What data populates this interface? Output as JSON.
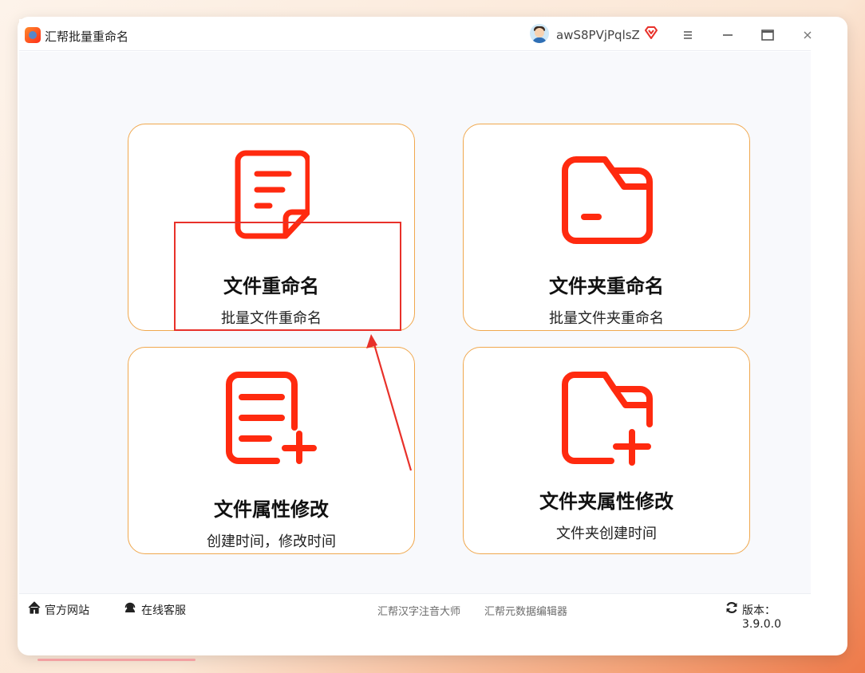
{
  "window": {
    "title": "汇帮批量重命名",
    "username": "awS8PVjPqlsZ",
    "controls": {
      "menu": "≡",
      "minimize": "—",
      "maximize": "▭",
      "close": "×"
    }
  },
  "cards": [
    {
      "title": "文件重命名",
      "subtitle": "批量文件重命名",
      "icon": "file-text-icon"
    },
    {
      "title": "文件夹重命名",
      "subtitle": "批量文件夹重命名",
      "icon": "folder-icon"
    },
    {
      "title": "文件属性修改",
      "subtitle": "创建时间，修改时间",
      "icon": "file-plus-icon"
    },
    {
      "title": "文件夹属性修改",
      "subtitle": "文件夹创建时间",
      "icon": "folder-plus-icon"
    }
  ],
  "footer": {
    "website": "官方网站",
    "support": "在线客服",
    "app_link_1": "汇帮汉字注音大师",
    "app_link_2": "汇帮元数据编辑器",
    "version": "版本：3.9.0.0"
  },
  "colors": {
    "accent": "#ff2a0f",
    "card_border": "#f0a84e",
    "annotation": "#e8312a"
  }
}
